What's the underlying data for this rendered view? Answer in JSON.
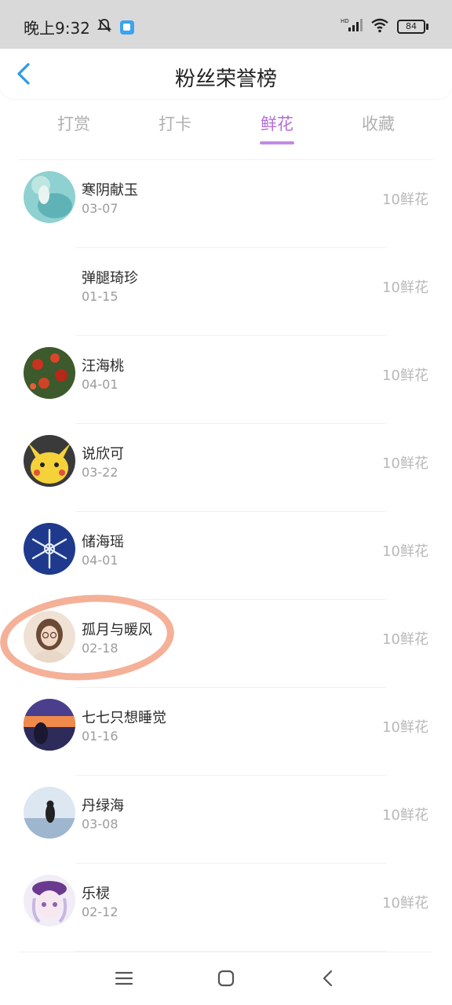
{
  "status_bar": {
    "time": "晚上9:32",
    "battery": "84",
    "hd": "HD"
  },
  "header": {
    "title": "粉丝荣誉榜"
  },
  "tabs": [
    {
      "label": "打赏",
      "active": false
    },
    {
      "label": "打卡",
      "active": false
    },
    {
      "label": "鲜花",
      "active": true
    },
    {
      "label": "收藏",
      "active": false
    }
  ],
  "fans": [
    {
      "name": "寒阴献玉",
      "date": "03-07",
      "amount": "10鲜花"
    },
    {
      "name": "弹腿琦珍",
      "date": "01-15",
      "amount": "10鲜花"
    },
    {
      "name": "汪海桃",
      "date": "04-01",
      "amount": "10鲜花"
    },
    {
      "name": "说欣可",
      "date": "03-22",
      "amount": "10鲜花"
    },
    {
      "name": "储海瑶",
      "date": "04-01",
      "amount": "10鲜花"
    },
    {
      "name": "孤月与暖风",
      "date": "02-18",
      "amount": "10鲜花"
    },
    {
      "name": "七七只想睡觉",
      "date": "01-16",
      "amount": "10鲜花"
    },
    {
      "name": "丹绿海",
      "date": "03-08",
      "amount": "10鲜花"
    },
    {
      "name": "乐棂",
      "date": "02-12",
      "amount": "10鲜花"
    }
  ],
  "colors": {
    "accent": "#b36edb",
    "underline": "#c18ae6",
    "highlight": "#f4a98f",
    "back_icon": "#2b9ae6"
  }
}
